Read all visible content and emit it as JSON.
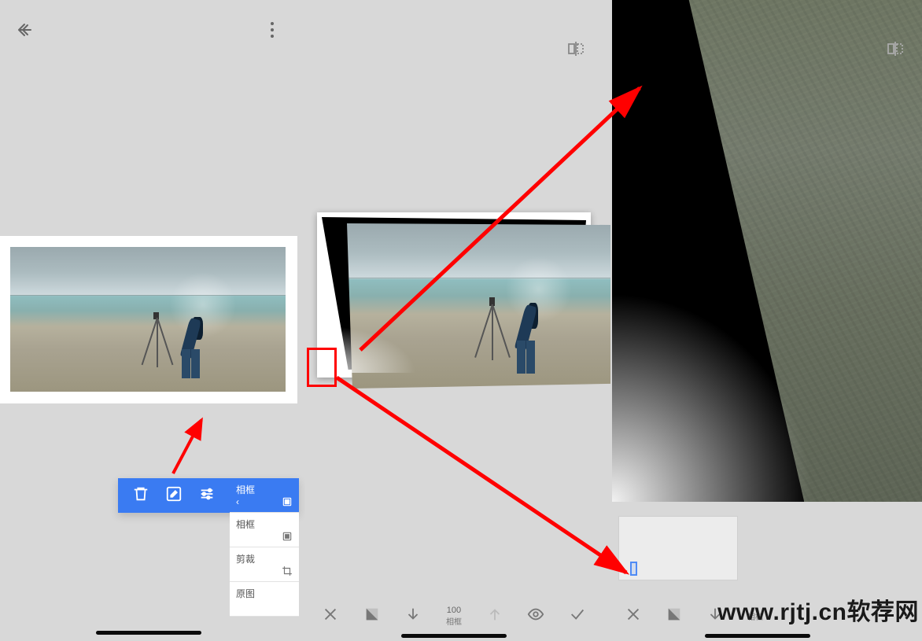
{
  "colors": {
    "accent": "#3a7bf2",
    "annotation": "#ff0000"
  },
  "watermark": "www.rjtj.cn软荐网",
  "panel1": {
    "toolbar": {
      "frame_label": "相框",
      "menu": {
        "frame": "相框",
        "crop": "剪裁",
        "original": "原图"
      }
    }
  },
  "panel2": {
    "slider": {
      "value": "100",
      "label": "相框"
    }
  },
  "panel3": {
    "slider": {
      "label": "相框"
    }
  }
}
